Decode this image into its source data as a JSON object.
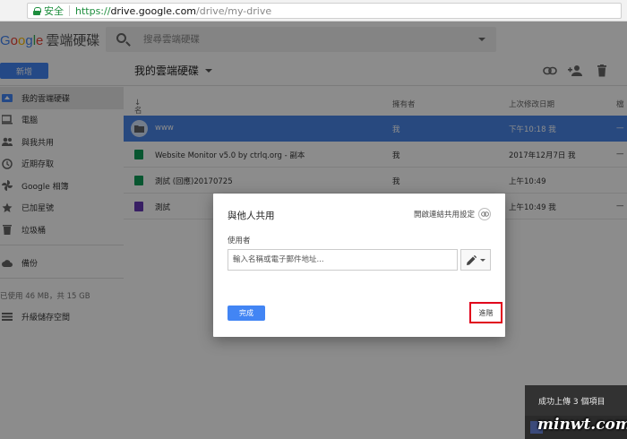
{
  "browser": {
    "secure_label": "安全",
    "url_scheme": "https://",
    "url_host": "drive.google.com",
    "url_path": "/drive/my-drive"
  },
  "header": {
    "logo_google": "Google",
    "product_name": "雲端硬碟",
    "search_placeholder": "搜尋雲端硬碟"
  },
  "toolbar": {
    "new_label": "新增",
    "title": "我的雲端硬碟"
  },
  "sidebar": {
    "items": [
      {
        "label": "我的雲端硬碟",
        "icon": "drive-icon"
      },
      {
        "label": "電腦",
        "icon": "computer-icon"
      },
      {
        "label": "與我共用",
        "icon": "people-icon"
      },
      {
        "label": "近期存取",
        "icon": "clock-icon"
      },
      {
        "label": "Google 相簿",
        "icon": "pinwheel-icon"
      },
      {
        "label": "已加星號",
        "icon": "star-icon"
      },
      {
        "label": "垃圾桶",
        "icon": "trash-icon"
      }
    ],
    "backup_label": "備份",
    "storage_text": "已使用 46 MB，共 15 GB",
    "upgrade_label": "升級儲存空間"
  },
  "file_list": {
    "columns": {
      "name": "名稱",
      "owner": "擁有者",
      "modified": "上次修改日期",
      "size": "檔"
    },
    "rows": [
      {
        "name": "www",
        "owner": "我",
        "modified": "下午10:18 我",
        "type": "folder"
      },
      {
        "name": "Website Monitor v5.0 by ctrlq.org - 副本",
        "owner": "我",
        "modified": "2017年12月7日 我",
        "type": "sheet"
      },
      {
        "name": "測試 (回應)20170725",
        "owner": "我",
        "modified": "上午10:49",
        "type": "sheet"
      },
      {
        "name": "測試",
        "owner": "",
        "modified": "上午10:49 我",
        "type": "form"
      }
    ]
  },
  "dialog": {
    "title": "與他人共用",
    "link_share_label": "開啟連結共用設定",
    "people_label": "使用者",
    "people_placeholder": "輸入名稱或電子郵件地址...",
    "done_label": "完成",
    "advanced_label": "進階"
  },
  "toast": {
    "message": "成功上傳 3 個項目"
  },
  "colors": {
    "accent_blue": "#4285f4",
    "selected_row": "#4a86e8",
    "highlight_red": "#e0001b",
    "sheet_green": "#0f9d58",
    "form_purple": "#673ab7"
  }
}
